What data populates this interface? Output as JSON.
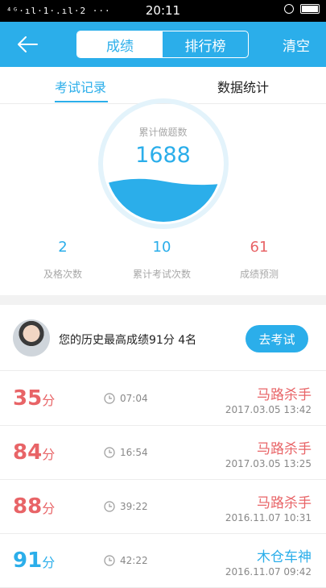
{
  "status_bar": {
    "signal": "⁴ᴳ·ıl·1·.ıl·2 ···",
    "time": "20:11"
  },
  "header": {
    "tabs": [
      "成绩",
      "排行榜"
    ],
    "active_tab": 0,
    "clear_label": "清空"
  },
  "subtabs": {
    "items": [
      "考试记录",
      "数据统计"
    ],
    "active": 0
  },
  "summary": {
    "gauge_label": "累计做题数",
    "total_questions": "1688",
    "gauge_fill_fraction": 0.35,
    "stats": [
      {
        "value": "2",
        "label": "及格次数",
        "color": "#2baeea"
      },
      {
        "value": "10",
        "label": "累计考试次数",
        "color": "#2baeea"
      },
      {
        "value": "61",
        "label": "成绩预测",
        "color": "#e86467"
      }
    ]
  },
  "best": {
    "text": "您的历史最高成绩91分  4名",
    "button_label": "去考试"
  },
  "records": [
    {
      "score": "35",
      "unit": "分",
      "duration": "07:04",
      "title": "马路杀手",
      "date": "2017.03.05  13:42",
      "color": "red"
    },
    {
      "score": "84",
      "unit": "分",
      "duration": "16:54",
      "title": "马路杀手",
      "date": "2017.03.05  13:25",
      "color": "red"
    },
    {
      "score": "88",
      "unit": "分",
      "duration": "39:22",
      "title": "马路杀手",
      "date": "2016.11.07  10:31",
      "color": "red"
    },
    {
      "score": "91",
      "unit": "分",
      "duration": "42:22",
      "title": "木仓车神",
      "date": "2016.11.07  09:42",
      "color": "blue"
    }
  ],
  "colors": {
    "accent": "#2baeea",
    "fail": "#e86467"
  }
}
